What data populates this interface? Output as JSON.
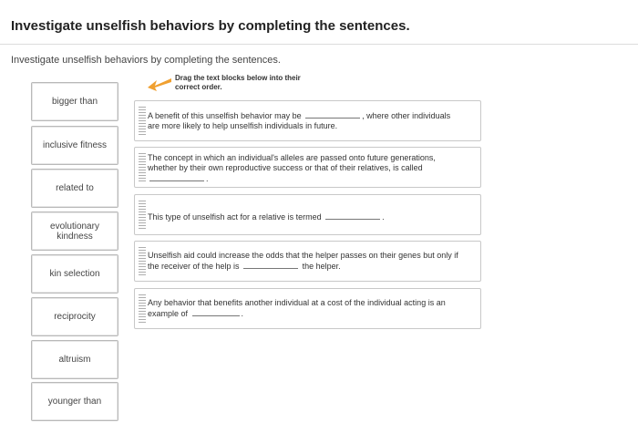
{
  "header": {
    "title": "Investigate unselfish behaviors by completing the sentences."
  },
  "instructions": "Investigate unselfish behaviors by completing the sentences.",
  "hint": {
    "line1": "Drag the text blocks below into their",
    "line2": "correct order.",
    "arrow_color": "#f0a030"
  },
  "word_bank": [
    "bigger than",
    "inclusive fitness",
    "related to",
    "evolutionary kindness",
    "kin selection",
    "reciprocity",
    "altruism",
    "younger than"
  ],
  "sentences": [
    {
      "pre": "A benefit of this unselfish behavior may be",
      "post": ", where other individuals are more likely to help unselfish individuals in future."
    },
    {
      "pre": "The concept in which an individual's alleles are passed onto future generations, whether by their own reproductive success or that of their relatives, is called",
      "post": "."
    },
    {
      "pre": "This type of unselfish act for a relative is termed",
      "post": "."
    },
    {
      "pre": "Unselfish aid could increase the odds that the helper passes on their genes but only if the receiver of the help is",
      "post": "the helper."
    },
    {
      "pre": "Any behavior that benefits another individual at a cost of the individual acting is an example of",
      "post": "."
    }
  ]
}
